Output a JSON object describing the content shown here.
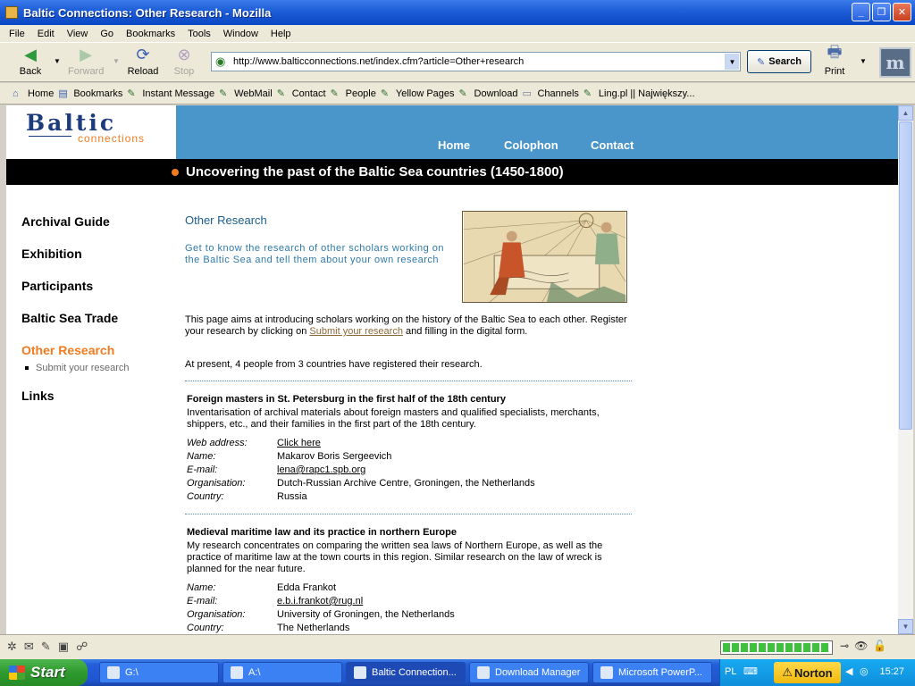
{
  "window": {
    "title": "Baltic Connections: Other Research - Mozilla"
  },
  "menu": [
    "File",
    "Edit",
    "View",
    "Go",
    "Bookmarks",
    "Tools",
    "Window",
    "Help"
  ],
  "nav": {
    "back": "Back",
    "forward": "Forward",
    "reload": "Reload",
    "stop": "Stop",
    "url": "http://www.balticconnections.net/index.cfm?article=Other+research",
    "search": "Search",
    "print": "Print"
  },
  "bookmarks": [
    "Home",
    "Bookmarks",
    "Instant Message",
    "WebMail",
    "Contact",
    "People",
    "Yellow Pages",
    "Download",
    "Channels",
    "Ling.pl || Największy..."
  ],
  "site": {
    "logo_main": "Baltic",
    "logo_sub": "connections",
    "topnav": [
      "Home",
      "Colophon",
      "Contact"
    ],
    "tagline": "Uncovering the past of the Baltic Sea countries (1450-1800)"
  },
  "sidenav": {
    "items": [
      "Archival Guide",
      "Exhibition",
      "Participants",
      "Baltic Sea Trade",
      "Other Research",
      "Links"
    ],
    "subitem": "Submit your research"
  },
  "content": {
    "heading": "Other Research",
    "intro": "Get to know the research of other scholars working on the Baltic Sea and tell them about your own research",
    "para1_a": "This page aims at introducing scholars working on the history of the Baltic Sea to each other. Register your research by clicking on ",
    "para1_link": "Submit your research",
    "para1_b": " and filling in the digital form.",
    "para2": "At present, 4 people from 3 countries have registered their research.",
    "labels": {
      "web": "Web address:",
      "name": "Name:",
      "email": "E-mail:",
      "org": "Organisation:",
      "country": "Country:"
    },
    "entries": [
      {
        "title": "Foreign masters in St. Petersburg in the first half of the 18th century",
        "desc": "Inventarisation of archival materials about foreign masters and qualified specialists, merchants, shippers, etc., and their families in the first part of the 18th century.",
        "web": "Click here",
        "name": "Makarov Boris Sergeevich",
        "email": "lena@rapc1.spb.org",
        "org": "Dutch-Russian Archive Centre, Groningen, the Netherlands",
        "country": "Russia"
      },
      {
        "title": "Medieval maritime law and its practice in northern Europe",
        "desc": "My research concentrates on comparing the written sea laws of Northern Europe, as well as the practice of maritime law at the town courts in this region. Similar research on the law of wreck is planned for the near future.",
        "name": "Edda Frankot",
        "email": "e.b.i.frankot@rug.nl",
        "org": "University of Groningen, the Netherlands",
        "country": "The Netherlands"
      }
    ]
  },
  "taskbar": {
    "start": "Start",
    "tasks": [
      "G:\\",
      "A:\\",
      "Baltic Connection...",
      "Download Manager",
      "Microsoft PowerP..."
    ],
    "lang": "PL",
    "norton": "Norton",
    "clock": "15:27"
  },
  "colors": {
    "accent_orange": "#f07b20",
    "header_blue": "#4a96cb",
    "heading_blue": "#1a5e8a",
    "logo_navy": "#1b3b7c"
  }
}
